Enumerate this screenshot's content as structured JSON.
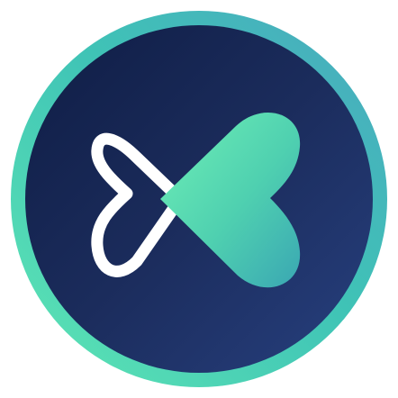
{
  "icon": {
    "name": "heart-x-logo",
    "ring_gradient": [
      "#5ee6b4",
      "#3fc3b6",
      "#4aa9c0"
    ],
    "badge_gradient": [
      "#0f1d45",
      "#1b2c5c",
      "#27407f"
    ],
    "outline_heart_color": "#ffffff",
    "filled_heart_gradient": [
      "#6ff0b6",
      "#4fd0b0",
      "#3aa7b3"
    ]
  }
}
